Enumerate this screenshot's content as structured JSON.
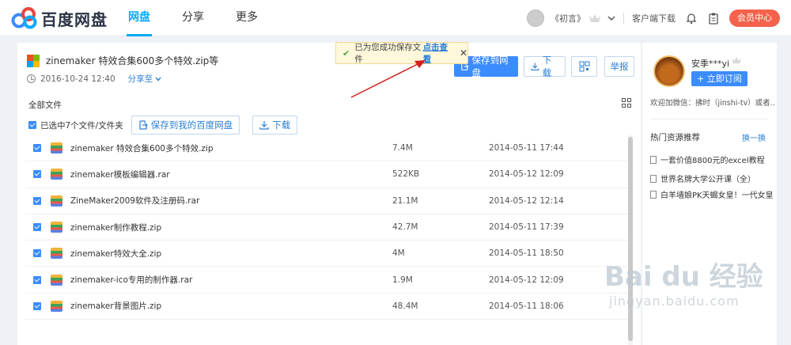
{
  "header": {
    "brand": "百度网盘",
    "nav": [
      "网盘",
      "分享",
      "更多"
    ],
    "user_name": "《初言》",
    "client_download": "客户端下载",
    "vip_center": "会员中心"
  },
  "share": {
    "file_title": "zinemaker 特效合集600多个特效.zip等",
    "date": "2016-10-24 12:40",
    "share_to": "分享至",
    "save_button": "保存到网盘",
    "download_button": "下载",
    "report_button": "举报"
  },
  "toast": {
    "message": "已为您成功保存文件",
    "link": "点击查看"
  },
  "list": {
    "all_files": "全部文件",
    "selected_info": "已选中7个文件/文件夹",
    "save_to_mine": "保存到我的百度网盘",
    "download": "下载",
    "files": [
      {
        "name": "zinemaker 特效合集600多个特效.zip",
        "size": "7.4M",
        "date": "2014-05-11 17:44"
      },
      {
        "name": "zinemaker模板编辑器.rar",
        "size": "522KB",
        "date": "2014-05-12 12:09"
      },
      {
        "name": "ZineMaker2009软件及注册码.rar",
        "size": "21.1M",
        "date": "2014-05-12 12:14"
      },
      {
        "name": "zinemaker制作教程.zip",
        "size": "42.7M",
        "date": "2014-05-11 17:39"
      },
      {
        "name": "zinemaker特效大全.zip",
        "size": "4M",
        "date": "2014-05-11 18:50"
      },
      {
        "name": "zinemaker-ico专用的制作器.rar",
        "size": "1.9M",
        "date": "2014-05-12 12:09"
      },
      {
        "name": "zinemaker背景图片.zip",
        "size": "48.4M",
        "date": "2014-05-11 18:06"
      }
    ]
  },
  "sidebar": {
    "name": "安季***yi",
    "subscribe": "+ 立即订阅",
    "desc": "欢迎加微信：拂时（jinshi-tv）或者...",
    "hot_title": "热门资源推荐",
    "swap": "换一换",
    "hot_items": [
      "一套价值8800元的excel教程",
      "世界名牌大学公开课（全）",
      "白羊墙娘PK天蝎女皇！一代女皇..."
    ]
  },
  "watermark": {
    "main": "Bai du 经验",
    "sub": "jingyan.baidu.com"
  },
  "colors": {
    "brand": "#09aaff",
    "primary": "#3b8cff",
    "vip": "#f5624c",
    "annotation_arrow": "#d42020"
  }
}
